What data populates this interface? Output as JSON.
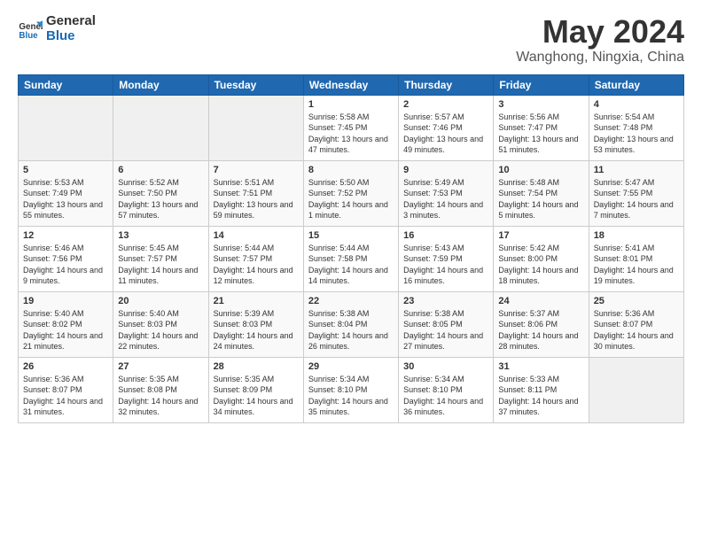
{
  "logo": {
    "line1": "General",
    "line2": "Blue"
  },
  "title": "May 2024",
  "subtitle": "Wanghong, Ningxia, China",
  "days_of_week": [
    "Sunday",
    "Monday",
    "Tuesday",
    "Wednesday",
    "Thursday",
    "Friday",
    "Saturday"
  ],
  "weeks": [
    [
      {
        "num": "",
        "sunrise": "",
        "sunset": "",
        "daylight": ""
      },
      {
        "num": "",
        "sunrise": "",
        "sunset": "",
        "daylight": ""
      },
      {
        "num": "",
        "sunrise": "",
        "sunset": "",
        "daylight": ""
      },
      {
        "num": "1",
        "sunrise": "5:58 AM",
        "sunset": "7:45 PM",
        "daylight": "13 hours and 47 minutes."
      },
      {
        "num": "2",
        "sunrise": "5:57 AM",
        "sunset": "7:46 PM",
        "daylight": "13 hours and 49 minutes."
      },
      {
        "num": "3",
        "sunrise": "5:56 AM",
        "sunset": "7:47 PM",
        "daylight": "13 hours and 51 minutes."
      },
      {
        "num": "4",
        "sunrise": "5:54 AM",
        "sunset": "7:48 PM",
        "daylight": "13 hours and 53 minutes."
      }
    ],
    [
      {
        "num": "5",
        "sunrise": "5:53 AM",
        "sunset": "7:49 PM",
        "daylight": "13 hours and 55 minutes."
      },
      {
        "num": "6",
        "sunrise": "5:52 AM",
        "sunset": "7:50 PM",
        "daylight": "13 hours and 57 minutes."
      },
      {
        "num": "7",
        "sunrise": "5:51 AM",
        "sunset": "7:51 PM",
        "daylight": "13 hours and 59 minutes."
      },
      {
        "num": "8",
        "sunrise": "5:50 AM",
        "sunset": "7:52 PM",
        "daylight": "14 hours and 1 minute."
      },
      {
        "num": "9",
        "sunrise": "5:49 AM",
        "sunset": "7:53 PM",
        "daylight": "14 hours and 3 minutes."
      },
      {
        "num": "10",
        "sunrise": "5:48 AM",
        "sunset": "7:54 PM",
        "daylight": "14 hours and 5 minutes."
      },
      {
        "num": "11",
        "sunrise": "5:47 AM",
        "sunset": "7:55 PM",
        "daylight": "14 hours and 7 minutes."
      }
    ],
    [
      {
        "num": "12",
        "sunrise": "5:46 AM",
        "sunset": "7:56 PM",
        "daylight": "14 hours and 9 minutes."
      },
      {
        "num": "13",
        "sunrise": "5:45 AM",
        "sunset": "7:57 PM",
        "daylight": "14 hours and 11 minutes."
      },
      {
        "num": "14",
        "sunrise": "5:44 AM",
        "sunset": "7:57 PM",
        "daylight": "14 hours and 12 minutes."
      },
      {
        "num": "15",
        "sunrise": "5:44 AM",
        "sunset": "7:58 PM",
        "daylight": "14 hours and 14 minutes."
      },
      {
        "num": "16",
        "sunrise": "5:43 AM",
        "sunset": "7:59 PM",
        "daylight": "14 hours and 16 minutes."
      },
      {
        "num": "17",
        "sunrise": "5:42 AM",
        "sunset": "8:00 PM",
        "daylight": "14 hours and 18 minutes."
      },
      {
        "num": "18",
        "sunrise": "5:41 AM",
        "sunset": "8:01 PM",
        "daylight": "14 hours and 19 minutes."
      }
    ],
    [
      {
        "num": "19",
        "sunrise": "5:40 AM",
        "sunset": "8:02 PM",
        "daylight": "14 hours and 21 minutes."
      },
      {
        "num": "20",
        "sunrise": "5:40 AM",
        "sunset": "8:03 PM",
        "daylight": "14 hours and 22 minutes."
      },
      {
        "num": "21",
        "sunrise": "5:39 AM",
        "sunset": "8:03 PM",
        "daylight": "14 hours and 24 minutes."
      },
      {
        "num": "22",
        "sunrise": "5:38 AM",
        "sunset": "8:04 PM",
        "daylight": "14 hours and 26 minutes."
      },
      {
        "num": "23",
        "sunrise": "5:38 AM",
        "sunset": "8:05 PM",
        "daylight": "14 hours and 27 minutes."
      },
      {
        "num": "24",
        "sunrise": "5:37 AM",
        "sunset": "8:06 PM",
        "daylight": "14 hours and 28 minutes."
      },
      {
        "num": "25",
        "sunrise": "5:36 AM",
        "sunset": "8:07 PM",
        "daylight": "14 hours and 30 minutes."
      }
    ],
    [
      {
        "num": "26",
        "sunrise": "5:36 AM",
        "sunset": "8:07 PM",
        "daylight": "14 hours and 31 minutes."
      },
      {
        "num": "27",
        "sunrise": "5:35 AM",
        "sunset": "8:08 PM",
        "daylight": "14 hours and 32 minutes."
      },
      {
        "num": "28",
        "sunrise": "5:35 AM",
        "sunset": "8:09 PM",
        "daylight": "14 hours and 34 minutes."
      },
      {
        "num": "29",
        "sunrise": "5:34 AM",
        "sunset": "8:10 PM",
        "daylight": "14 hours and 35 minutes."
      },
      {
        "num": "30",
        "sunrise": "5:34 AM",
        "sunset": "8:10 PM",
        "daylight": "14 hours and 36 minutes."
      },
      {
        "num": "31",
        "sunrise": "5:33 AM",
        "sunset": "8:11 PM",
        "daylight": "14 hours and 37 minutes."
      },
      {
        "num": "",
        "sunrise": "",
        "sunset": "",
        "daylight": ""
      }
    ]
  ],
  "labels": {
    "sunrise": "Sunrise:",
    "sunset": "Sunset:",
    "daylight": "Daylight:"
  }
}
